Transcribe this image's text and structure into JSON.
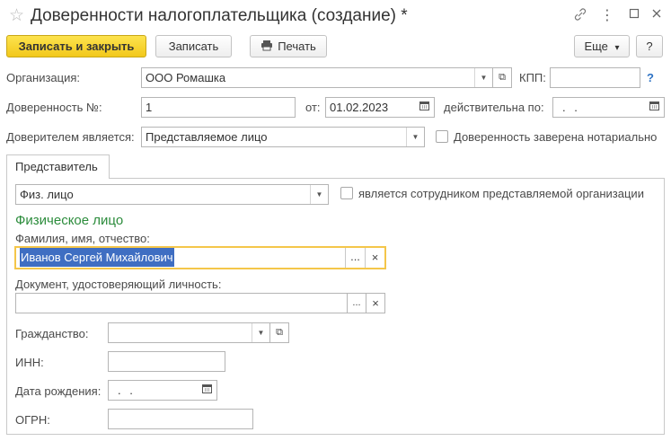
{
  "window": {
    "title": "Доверенности налогоплательщика (создание) *",
    "star_icon": "star-icon",
    "link_icon": "link-icon",
    "more_icon": "more-vertical-icon",
    "maximize_icon": "maximize-icon",
    "close_icon": "close-icon"
  },
  "toolbar": {
    "save_close_label": "Записать и закрыть",
    "save_label": "Записать",
    "print_label": "Печать",
    "more_label": "Еще",
    "help_label": "?"
  },
  "form": {
    "org_label": "Организация:",
    "org_value": "ООО Ромашка",
    "kpp_label": "КПП:",
    "kpp_value": "",
    "kpp_help": "?",
    "number_label": "Доверенность №:",
    "number_value": "1",
    "date_from_label": "от:",
    "date_from_value": "01.02.2023",
    "valid_to_label": "действительна по:",
    "valid_to_value": ". .",
    "principal_label": "Доверителем является:",
    "principal_value": "Представляемое лицо",
    "notarized_label": "Доверенность заверена нотариально",
    "notarized_checked": false
  },
  "tabs": {
    "active": "Представитель"
  },
  "representative": {
    "type_value": "Физ. лицо",
    "employee_label": "является сотрудником представляемой организации",
    "employee_checked": false,
    "section_title": "Физическое лицо",
    "fio_label": "Фамилия, имя, отчество:",
    "fio_value": "Иванов Сергей Михайлович",
    "doc_label": "Документ, удостоверяющий личность:",
    "doc_value": "",
    "citizenship_label": "Гражданство:",
    "citizenship_value": "",
    "inn_label": "ИНН:",
    "inn_value": "",
    "birth_label": "Дата рождения:",
    "birth_value": ". .",
    "ogrn_label": "ОГРН:",
    "ogrn_value": ""
  },
  "glyphs": {
    "dots": "...",
    "clear": "×",
    "open": "⧉",
    "dropdown": "▼",
    "calendar": "▦",
    "printer": "🖶",
    "chevron": "▾"
  }
}
